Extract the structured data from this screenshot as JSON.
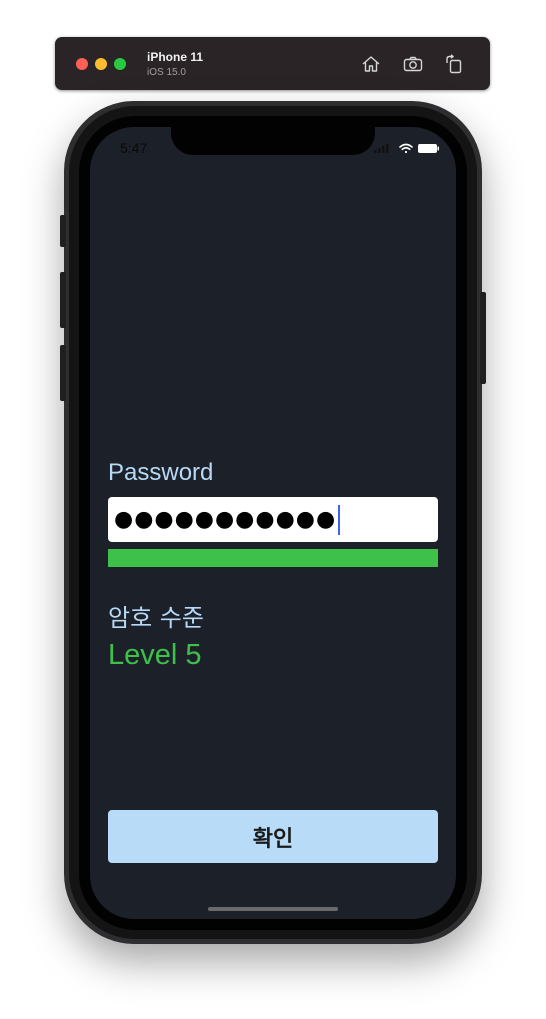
{
  "simulator": {
    "device_name": "iPhone 11",
    "os_version": "iOS 15.0",
    "toolbar_icons": [
      "home-icon",
      "screenshot-camera-icon",
      "rotate-icon"
    ]
  },
  "status_bar": {
    "time": "5:47",
    "icons": [
      "signal-icon",
      "wifi-icon",
      "battery-icon"
    ]
  },
  "form": {
    "password_label": "Password",
    "password_masked": "●●●●●●●●●●●",
    "strength_fraction": 1.0,
    "level_heading": "암호 수준",
    "level_value": "Level 5",
    "confirm_label": "확인"
  },
  "colors": {
    "screen_background": "#1c2028",
    "label_text": "#b7d9f5",
    "strength_green": "#3ec14a",
    "button_background": "#b8dcf8",
    "caret": "#3f63f0"
  }
}
